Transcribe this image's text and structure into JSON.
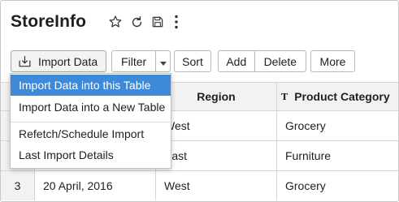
{
  "header": {
    "title": "StoreInfo",
    "icons": [
      "star-icon",
      "refresh-icon",
      "save-icon",
      "more-vertical-icon"
    ]
  },
  "toolbar": {
    "import_label": "Import Data",
    "filter_label": "Filter",
    "sort_label": "Sort",
    "add_label": "Add",
    "delete_label": "Delete",
    "more_label": "More"
  },
  "import_menu": {
    "items": [
      "Import Data into this Table",
      "Import Data into a New Table",
      "Refetch/Schedule Import",
      "Last Import Details"
    ],
    "highlighted_index": 0,
    "highlight_color": "#3f8ad8"
  },
  "table": {
    "columns": [
      "Region",
      "Product Category"
    ],
    "rows": [
      {
        "num": "",
        "date": "",
        "region": "West",
        "category": "Grocery"
      },
      {
        "num": "",
        "date": "",
        "region": "East",
        "category": "Furniture"
      },
      {
        "num": "3",
        "date": "20 April, 2016",
        "region": "West",
        "category": "Grocery"
      }
    ]
  }
}
